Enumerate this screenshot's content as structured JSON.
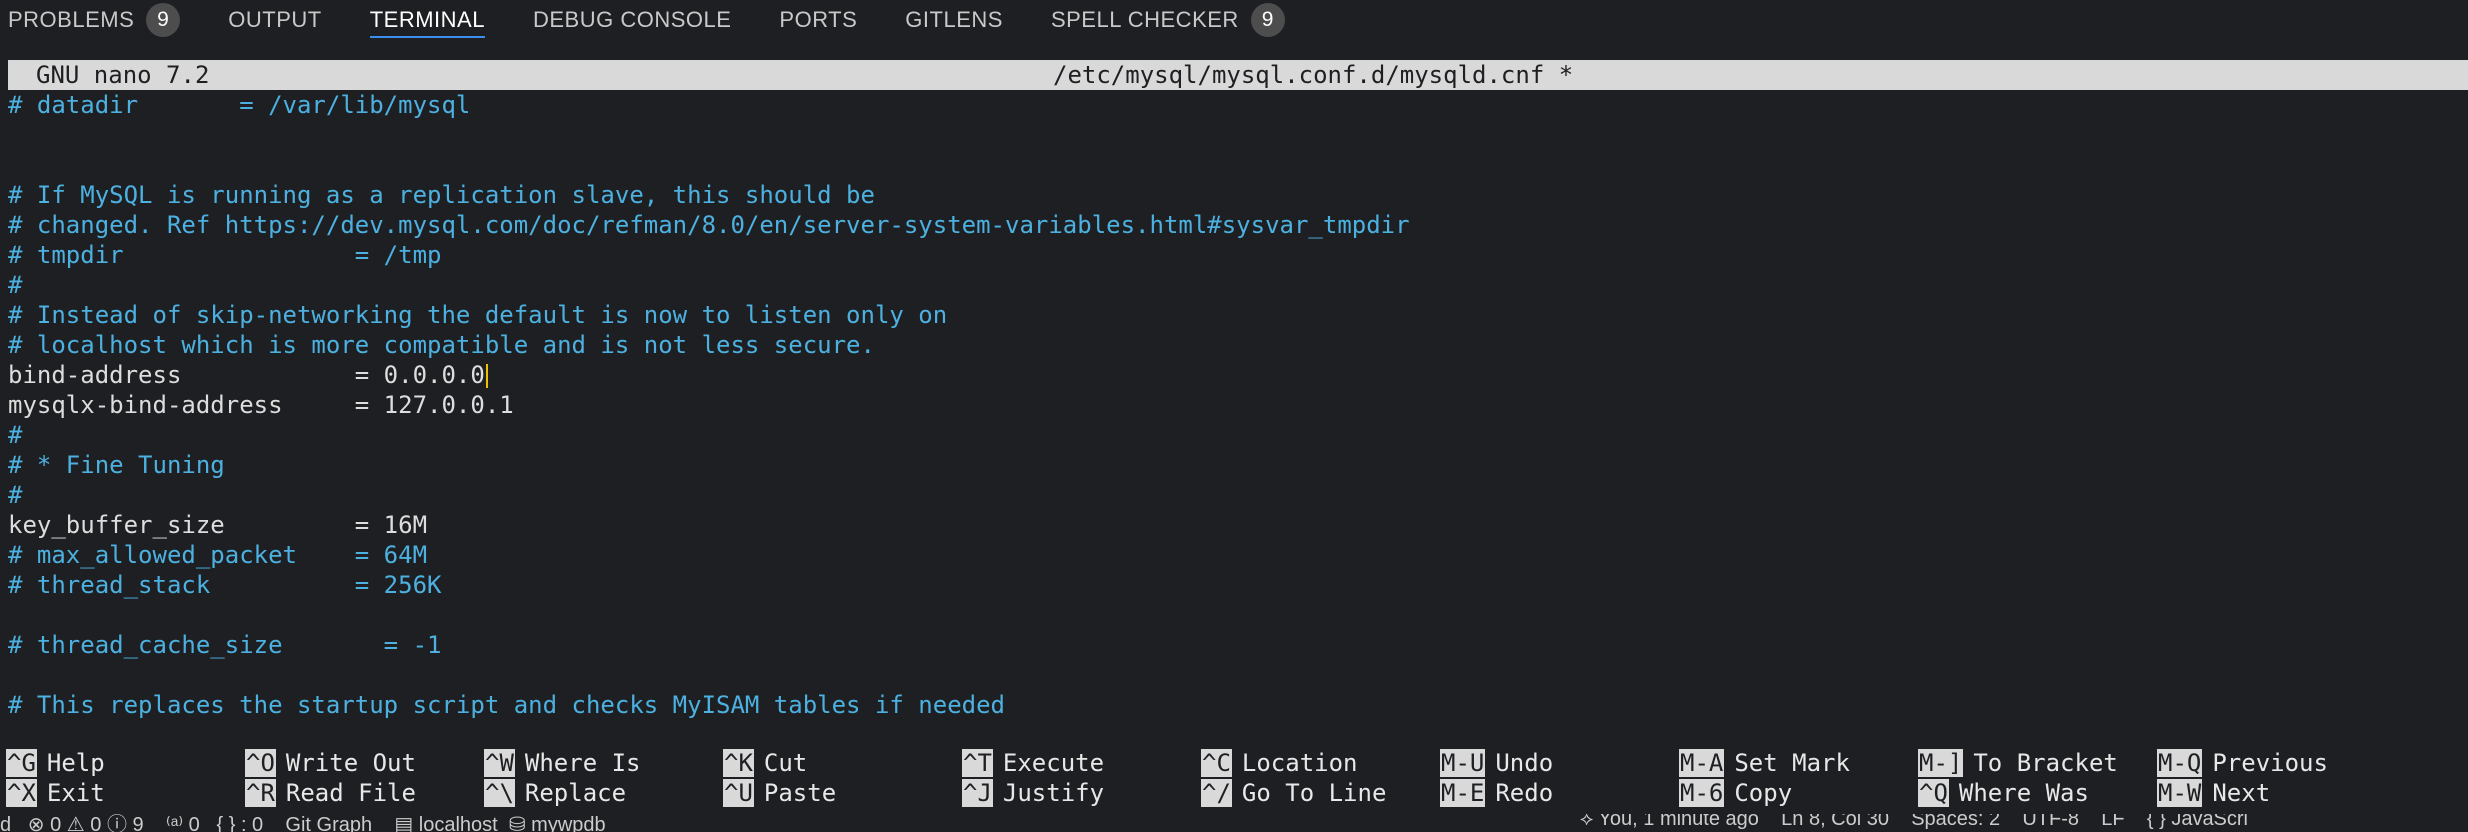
{
  "panel_tabs": [
    {
      "label": "PROBLEMS",
      "badge": "9"
    },
    {
      "label": "OUTPUT"
    },
    {
      "label": "TERMINAL",
      "active": true
    },
    {
      "label": "DEBUG CONSOLE"
    },
    {
      "label": "PORTS"
    },
    {
      "label": "GITLENS"
    },
    {
      "label": "SPELL CHECKER",
      "badge": "9"
    }
  ],
  "nano": {
    "version": "GNU nano 7.2",
    "filename": "/etc/mysql/mysql.conf.d/mysqld.cnf *"
  },
  "lines": [
    {
      "text": "# datadir       = /var/lib/mysql",
      "kind": "comment"
    },
    {
      "text": "",
      "kind": "code"
    },
    {
      "text": "",
      "kind": "code"
    },
    {
      "text": "# If MySQL is running as a replication slave, this should be",
      "kind": "comment"
    },
    {
      "text": "# changed. Ref https://dev.mysql.com/doc/refman/8.0/en/server-system-variables.html#sysvar_tmpdir",
      "kind": "comment"
    },
    {
      "text": "# tmpdir                = /tmp",
      "kind": "comment"
    },
    {
      "text": "#",
      "kind": "comment"
    },
    {
      "text": "# Instead of skip-networking the default is now to listen only on",
      "kind": "comment"
    },
    {
      "text": "# localhost which is more compatible and is not less secure.",
      "kind": "comment"
    },
    {
      "text": "bind-address            = 0.0.0.0",
      "kind": "code",
      "cursor": true
    },
    {
      "text": "mysqlx-bind-address     = 127.0.0.1",
      "kind": "code"
    },
    {
      "text": "#",
      "kind": "comment"
    },
    {
      "text": "# * Fine Tuning",
      "kind": "comment"
    },
    {
      "text": "#",
      "kind": "comment"
    },
    {
      "text": "key_buffer_size         = 16M",
      "kind": "code"
    },
    {
      "text": "# max_allowed_packet    = 64M",
      "kind": "comment"
    },
    {
      "text": "# thread_stack          = 256K",
      "kind": "comment"
    },
    {
      "text": "",
      "kind": "code"
    },
    {
      "text": "# thread_cache_size       = -1",
      "kind": "comment"
    },
    {
      "text": "",
      "kind": "code"
    },
    {
      "text": "# This replaces the startup script and checks MyISAM tables if needed",
      "kind": "comment"
    }
  ],
  "shortcuts": [
    [
      {
        "key": "^G",
        "label": "Help"
      },
      {
        "key": "^X",
        "label": "Exit"
      }
    ],
    [
      {
        "key": "^O",
        "label": "Write Out"
      },
      {
        "key": "^R",
        "label": "Read File"
      }
    ],
    [
      {
        "key": "^W",
        "label": "Where Is"
      },
      {
        "key": "^\\",
        "label": "Replace"
      }
    ],
    [
      {
        "key": "^K",
        "label": "Cut"
      },
      {
        "key": "^U",
        "label": "Paste"
      }
    ],
    [
      {
        "key": "^T",
        "label": "Execute"
      },
      {
        "key": "^J",
        "label": "Justify"
      }
    ],
    [
      {
        "key": "^C",
        "label": "Location"
      },
      {
        "key": "^/",
        "label": "Go To Line"
      }
    ],
    [
      {
        "key": "M-U",
        "label": "Undo"
      },
      {
        "key": "M-E",
        "label": "Redo"
      }
    ],
    [
      {
        "key": "M-A",
        "label": "Set Mark"
      },
      {
        "key": "M-6",
        "label": "Copy"
      }
    ],
    [
      {
        "key": "M-]",
        "label": "To Bracket"
      },
      {
        "key": "^Q",
        "label": "Where Was"
      }
    ],
    [
      {
        "key": "M-Q",
        "label": "Previous"
      },
      {
        "key": "M-W",
        "label": "Next"
      }
    ]
  ],
  "statusbar": {
    "left": "d   ⊗ 0 ⚠ 0 ⓘ 9    ⁽ᵃ⁾ 0   { } : 0    Git Graph    ▤ localhost  ⛁ mywpdb",
    "right": "⟡ You, 1 minute ago    Ln 8, Col 30    Spaces: 2    UTF-8    LF    { } JavaScri"
  },
  "colors": {
    "comment": "#4cb1e0",
    "code": "#dddddd",
    "titlebar_bg": "#d9d9d9",
    "active_tab_underline": "#3b8eea",
    "cursor": "#f0c000"
  }
}
